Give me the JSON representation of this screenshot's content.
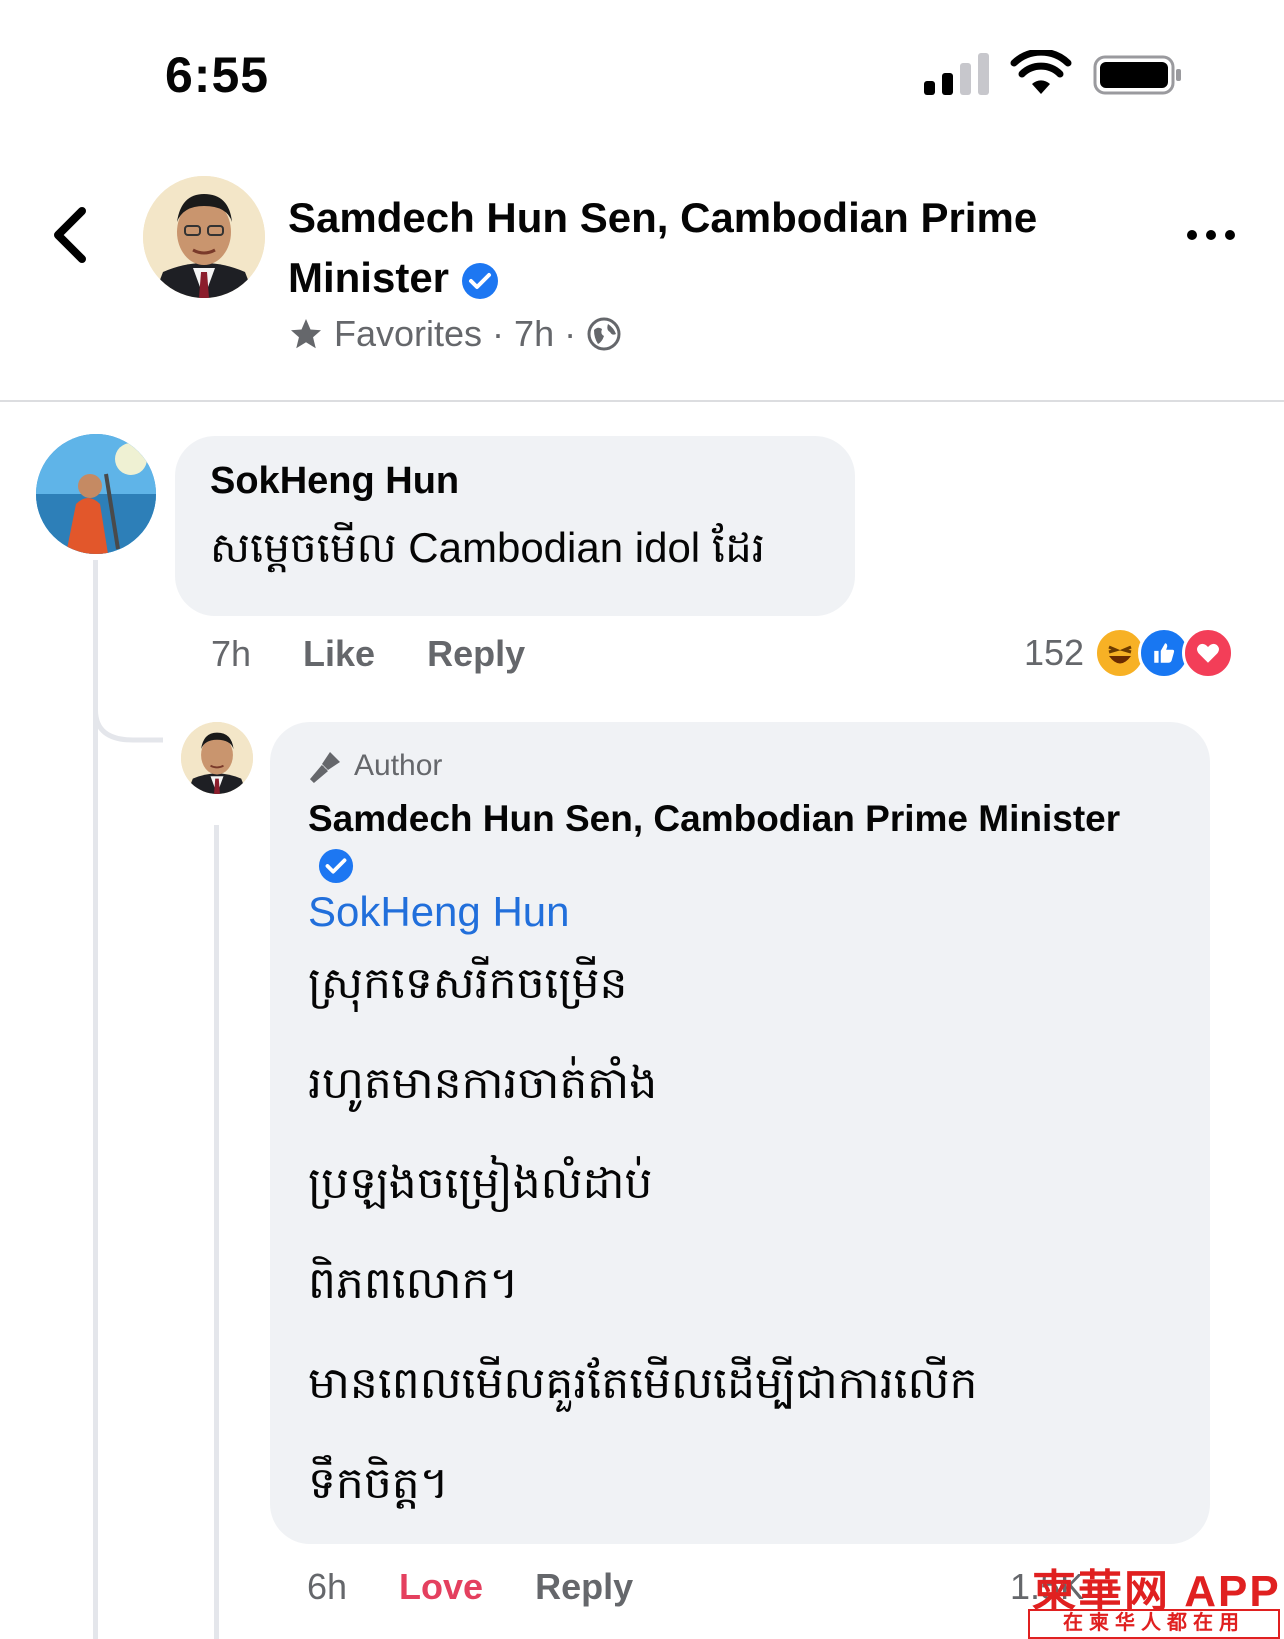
{
  "status_bar": {
    "time": "6:55"
  },
  "header": {
    "title": "Samdech Hun Sen, Cambodian Prime Minister",
    "favorites_label": "Favorites",
    "timestamp": "7h",
    "separator": "·"
  },
  "comment": {
    "author": "SokHeng Hun",
    "text": "សម្តេចមើល Cambodian idol ដែរ",
    "time": "7h",
    "like_label": "Like",
    "reply_label": "Reply",
    "reaction_count": "152",
    "reactions": [
      "haha-icon",
      "like-icon",
      "love-icon"
    ]
  },
  "reply": {
    "badge": "Author",
    "author": "Samdech Hun Sen, Cambodian Prime Minister",
    "mention": "SokHeng Hun",
    "lines": [
      "ស្រុកទេសរីកចម្រើន",
      "រហូតមានការចាត់តាំង",
      "ប្រឡងចម្រៀងលំដាប់",
      "ពិភពលោក។",
      "មានពេលមើលគួរតែមើលដើម្បីជាការលើក",
      "ទឹកចិត្ត។"
    ],
    "time": "6h",
    "love_label": "Love",
    "reply_label": "Reply",
    "reaction_count": "1.5K"
  },
  "watermark": {
    "top": "柬華网 APP",
    "bottom": "在柬华人都在用"
  },
  "colors": {
    "accent": "#216fdb",
    "love": "#e4405f",
    "muted": "#65676b",
    "bubble": "#f0f2f5"
  }
}
